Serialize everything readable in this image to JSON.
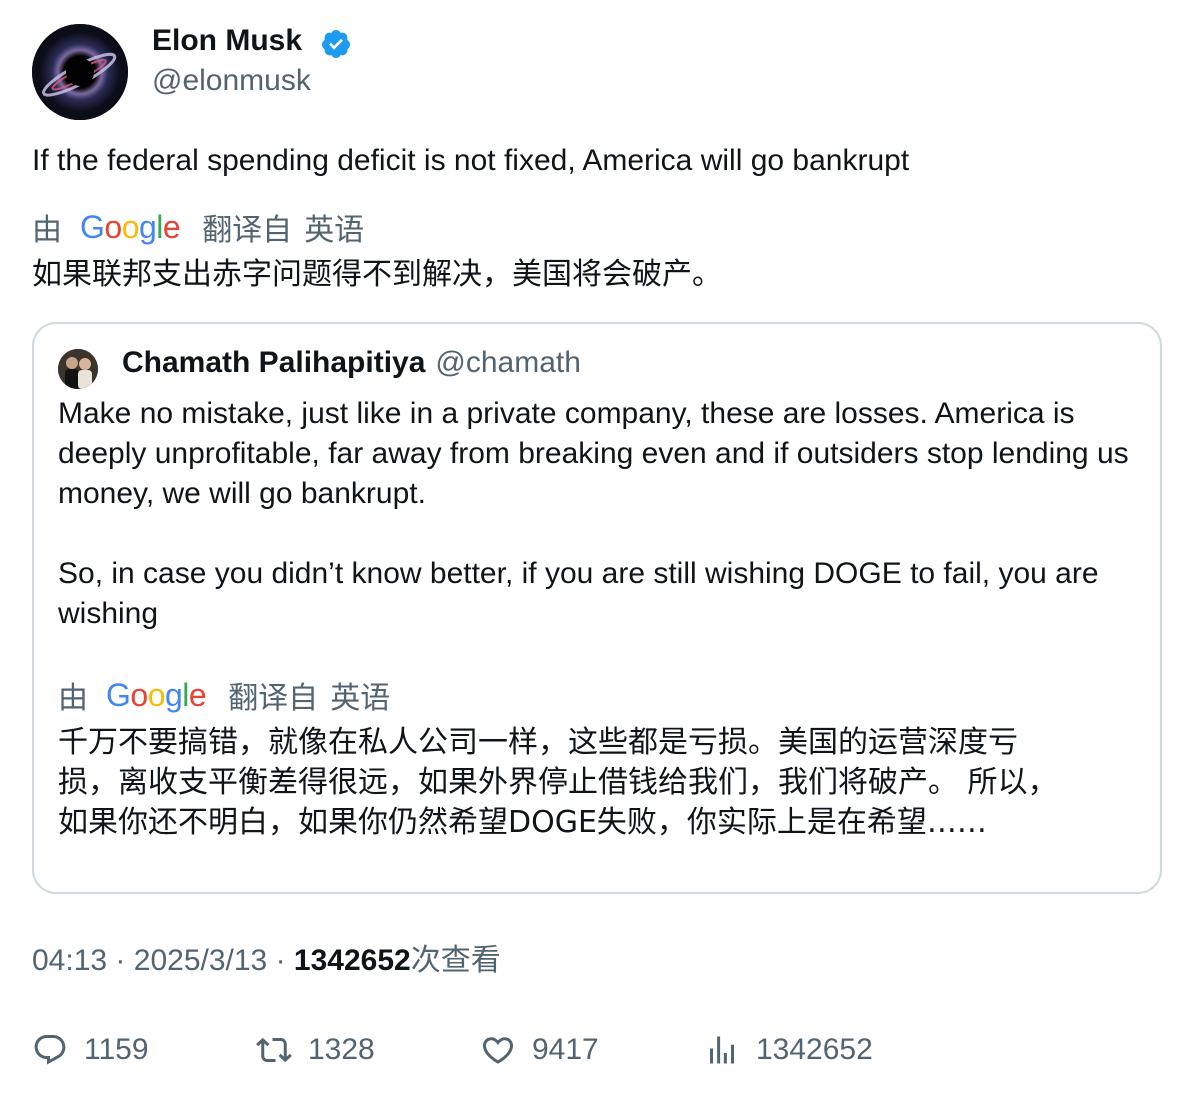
{
  "author": {
    "name": "Elon Musk",
    "handle": "@elonmusk",
    "verified": true,
    "verified_color": "#1d9bf0"
  },
  "tweet": {
    "text": "If the federal spending deficit is not fixed, America will go bankrupt",
    "translation": {
      "by": "由",
      "provider": "Google",
      "translated_from": "翻译自",
      "language": "英语",
      "text": "如果联邦支出赤字问题得不到解决，美国将会破产。"
    }
  },
  "quote": {
    "name": "Chamath Palihapitiya",
    "handle": "@chamath",
    "paragraph1": "Make no mistake, just like in a private company, these are losses. America is deeply unprofitable, far away from breaking even and if outsiders stop lending us money, we will go bankrupt.",
    "paragraph2": "So, in case you didn’t know better, if you are still wishing DOGE to fail, you are wishing",
    "translation": {
      "by": "由",
      "provider": "Google",
      "translated_from": "翻译自",
      "language": "英语",
      "line1": "千万不要搞错，就像在私人公司一样，这些都是亏损。美国的运营深度亏",
      "line2": "损，离收支平衡差得很远，如果外界停止借钱给我们，我们将破产。 所以，",
      "line3": "如果你还不明白，如果你仍然希望DOGE失败，你实际上是在希望……"
    }
  },
  "meta": {
    "time": "04:13",
    "sep1": "·",
    "date": "2025/3/13",
    "sep2": "·",
    "views": "1342652",
    "views_label": "次查看"
  },
  "actions": {
    "replies": "1159",
    "retweets": "1328",
    "likes": "9417",
    "views": "1342652"
  },
  "colors": {
    "google_blue": "#4285f4",
    "google_red": "#ea4335",
    "google_yellow": "#fbbc05",
    "google_green": "#34a853",
    "secondary_text": "#536471",
    "border": "#cfd9de"
  },
  "icons": [
    "reply-icon",
    "retweet-icon",
    "like-icon",
    "views-icon",
    "verified-badge-icon"
  ]
}
